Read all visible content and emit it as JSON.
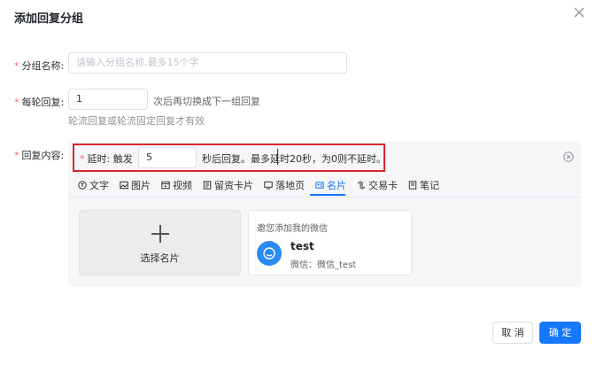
{
  "dialog": {
    "title": "添加回复分组",
    "close_icon": "close-icon"
  },
  "form": {
    "group_name": {
      "label": "分组名称:",
      "placeholder": "请输入分组名称,最多15个字",
      "value": ""
    },
    "rounds": {
      "label": "每轮回复:",
      "value": "1",
      "suffix": "次后再切换成下一组回复",
      "hint": "轮流回复或轮流固定回复才有效"
    },
    "content": {
      "label": "回复内容:",
      "delay": {
        "label": "延时:",
        "prefix": "触发",
        "value": "5",
        "suffix": "秒后回复。最多延时20秒，为0则不延时。"
      }
    }
  },
  "tabs": [
    {
      "label": "文字",
      "icon": "text-icon"
    },
    {
      "label": "图片",
      "icon": "image-icon"
    },
    {
      "label": "视频",
      "icon": "video-icon"
    },
    {
      "label": "留资卡片",
      "icon": "lead-card-icon"
    },
    {
      "label": "落地页",
      "icon": "landing-page-icon"
    },
    {
      "label": "名片",
      "icon": "business-card-icon",
      "active": true
    },
    {
      "label": "交易卡",
      "icon": "trade-card-icon"
    },
    {
      "label": "笔记",
      "icon": "note-icon"
    }
  ],
  "select_card": {
    "label": "选择名片"
  },
  "contact_card": {
    "title": "邀您添加我的微信",
    "name": "test",
    "wechat_id": "微信：微信_test"
  },
  "footer": {
    "cancel_label": "取 消",
    "ok_label": "确 定"
  },
  "colors": {
    "primary": "#1677ff",
    "required": "#f56c6c",
    "highlight_box": "#d9262c",
    "panel_bg": "#f5f6f8"
  }
}
